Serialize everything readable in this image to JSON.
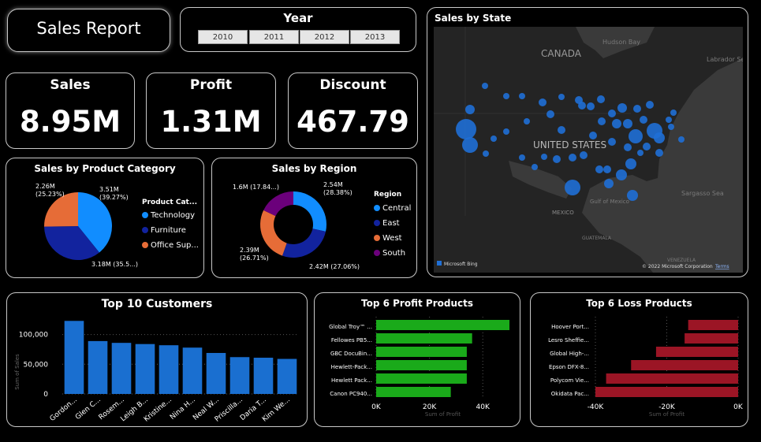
{
  "header": {
    "title": "Sales Report"
  },
  "year_slicer": {
    "label": "Year",
    "options": [
      "2010",
      "2011",
      "2012",
      "2013"
    ]
  },
  "kpis": {
    "sales": {
      "label": "Sales",
      "value": "8.95M"
    },
    "profit": {
      "label": "Profit",
      "value": "1.31M"
    },
    "discount": {
      "label": "Discount",
      "value": "467.79"
    }
  },
  "map": {
    "title": "Sales by State",
    "labels": {
      "canada": "CANADA",
      "us": "UNITED STATES",
      "mexico": "MEXICO",
      "hudson": "Hudson Bay",
      "labrador": "Labrador Se",
      "gulf": "Gulf of Mexico",
      "sargasso": "Sargasso Sea",
      "guatemala": "GUATEMALA",
      "venezuela": "VENEZUELA"
    },
    "bing": "Microsoft Bing",
    "copyright": "© 2022 Microsoft Corporation",
    "terms": "Terms"
  },
  "colors": {
    "technology": "#118DFF",
    "furniture": "#12239E",
    "office": "#E66C37",
    "south": "#6B007B",
    "bar_blue": "#1a6fd0",
    "profit_green": "#1aaa1a",
    "loss_red": "#9b1525",
    "map_bg": "#2b2b2b",
    "bubble": "#1f6fd6"
  },
  "chart_data": [
    {
      "type": "pie",
      "title": "Sales by Product Category",
      "legend_title": "Product Cat...",
      "categories": [
        "Technology",
        "Furniture",
        "Office Sup..."
      ],
      "values": [
        3.51,
        3.18,
        2.26
      ],
      "labels": [
        "3.51M\n(39.27%)",
        "3.18M (35.5...)",
        "2.26M\n(25.23%)"
      ],
      "legend": "right"
    },
    {
      "type": "pie",
      "subtype": "donut",
      "title": "Sales by Region",
      "legend_title": "Region",
      "categories": [
        "Central",
        "East",
        "West",
        "South"
      ],
      "values": [
        2.54,
        2.42,
        2.39,
        1.6
      ],
      "labels": [
        "2.54M\n(28.38%)",
        "2.42M (27.06%)",
        "2.39M\n(26.71%)",
        "1.6M (17.84...)"
      ],
      "legend": "right"
    },
    {
      "type": "bar",
      "title": "Top 10 Customers",
      "categories": [
        "Gordon...",
        "Glen C...",
        "Rosem...",
        "Leigh B...",
        "Kristine...",
        "Nina H...",
        "Neal W...",
        "Priscilla...",
        "Daria T...",
        "Kim We..."
      ],
      "values": [
        123000,
        89000,
        86000,
        84000,
        82000,
        78000,
        69000,
        62000,
        61000,
        59000
      ],
      "ylabel": "Sum of Sales",
      "ylim": [
        0,
        130000
      ],
      "yticks": [
        "0",
        "50,000",
        "100,000"
      ],
      "ytick_values": [
        0,
        50000,
        100000
      ]
    },
    {
      "type": "bar",
      "orientation": "horizontal",
      "title": "Top 6 Profit Products",
      "categories": [
        "Global Troy™ ...",
        "Fellowes PB5...",
        "GBC DocuBin...",
        "Hewlett-Pack...",
        "Hewlett Pack...",
        "Canon PC940..."
      ],
      "values": [
        50000,
        36000,
        34000,
        34000,
        34000,
        28000
      ],
      "xlabel": "Sum of Profit",
      "xlim": [
        0,
        50000
      ],
      "xticks": [
        "0K",
        "20K",
        "40K"
      ],
      "xtick_values": [
        0,
        20000,
        40000
      ]
    },
    {
      "type": "bar",
      "orientation": "horizontal",
      "title": "Top 6 Loss Products",
      "categories": [
        "Hoover Port...",
        "Lesro Sheffie...",
        "Global High-...",
        "Epson DFX-8...",
        "Polycom Vie...",
        "Okidata Pac..."
      ],
      "values": [
        -14000,
        -15000,
        -23000,
        -30000,
        -37000,
        -40000
      ],
      "xlabel": "Sum of Profit",
      "xlim": [
        -40000,
        0
      ],
      "xticks": [
        "-40K",
        "-20K",
        "0K"
      ],
      "xtick_values": [
        -40000,
        -20000,
        0
      ]
    }
  ]
}
